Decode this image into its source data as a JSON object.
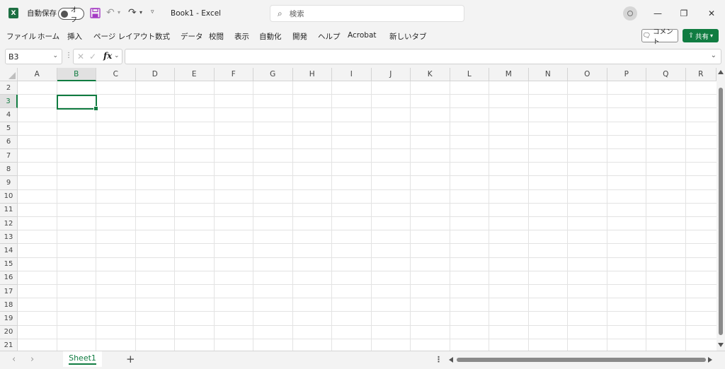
{
  "titlebar": {
    "logo_letter": "X",
    "autosave_label": "自動保存",
    "autosave_state": "オフ",
    "doc_title": "Book1  -  Excel",
    "search_placeholder": "検索"
  },
  "ribbon": {
    "tabs": [
      "ファイル",
      "ホーム",
      "挿入",
      "ページ レイアウト",
      "数式",
      "データ",
      "校閲",
      "表示",
      "自動化",
      "開発",
      "ヘルプ",
      "Acrobat",
      "新しいタブ"
    ],
    "comment_label": "コメント",
    "share_label": "共有"
  },
  "formula_bar": {
    "name_box": "B3",
    "fx_label": "fx",
    "formula": ""
  },
  "grid": {
    "columns": [
      "A",
      "B",
      "C",
      "D",
      "E",
      "F",
      "G",
      "H",
      "I",
      "J",
      "K",
      "L",
      "M",
      "N",
      "O",
      "P",
      "Q",
      "R"
    ],
    "rows": [
      "2",
      "3",
      "4",
      "5",
      "6",
      "7",
      "8",
      "9",
      "10",
      "11",
      "12",
      "13",
      "14",
      "15",
      "16",
      "17",
      "18",
      "19",
      "20",
      "21"
    ],
    "selected_column": "B",
    "selected_row": "3"
  },
  "sheets": {
    "tabs": [
      "Sheet1"
    ],
    "add_label": "+"
  },
  "colors": {
    "accent": "#107c41",
    "chrome": "#f3f3f3",
    "gridline": "#e3e3e3"
  }
}
